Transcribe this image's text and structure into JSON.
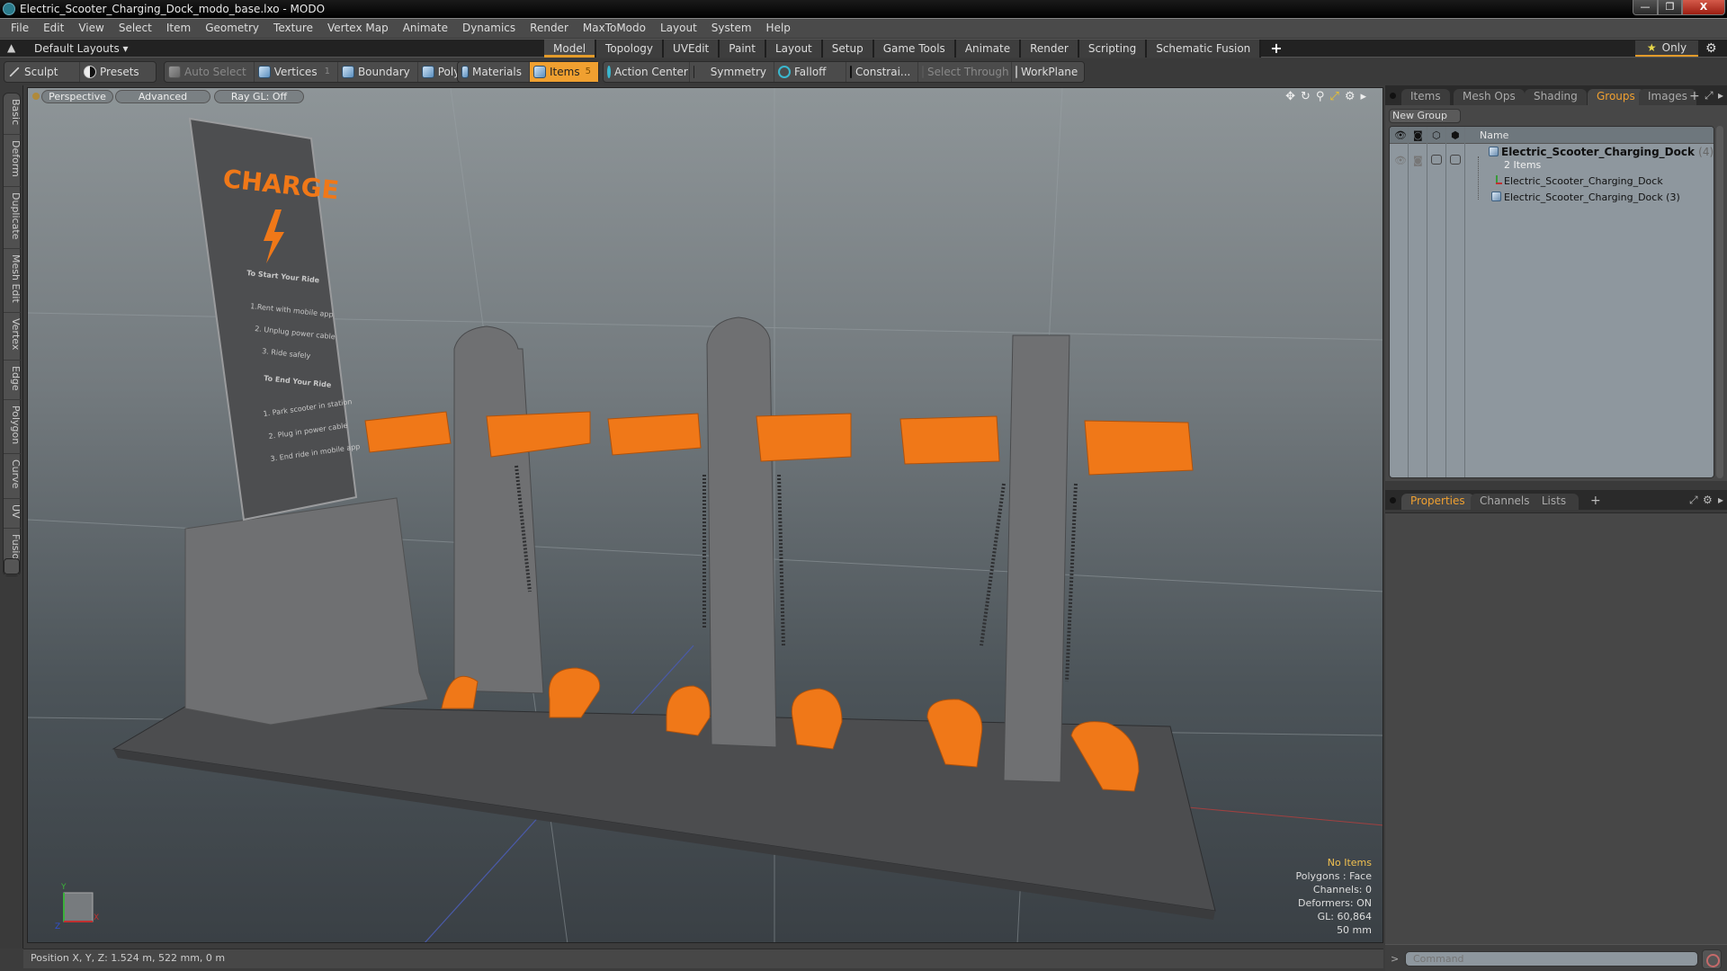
{
  "window": {
    "title": "Electric_Scooter_Charging_Dock_modo_base.lxo - MODO",
    "controls": {
      "minimize": "—",
      "maximize": "❐",
      "close": "X"
    }
  },
  "menu": [
    "File",
    "Edit",
    "View",
    "Select",
    "Item",
    "Geometry",
    "Texture",
    "Vertex Map",
    "Animate",
    "Dynamics",
    "Render",
    "MaxToModo",
    "Layout",
    "System",
    "Help"
  ],
  "layoutbar": {
    "layouts_label": "Default Layouts ▾",
    "tabs": [
      "Model",
      "Topology",
      "UVEdit",
      "Paint",
      "Layout",
      "Setup",
      "Game Tools",
      "Animate",
      "Render",
      "Scripting",
      "Schematic Fusion"
    ],
    "active_tab": "Model",
    "add_tab": "+",
    "only_label": "Only"
  },
  "toolbar": {
    "sculpt": "Sculpt",
    "presets": "Presets",
    "auto_select": "Auto Select",
    "vertices": "Vertices",
    "vertices_count": "1",
    "boundary": "Boundary",
    "polygons": "Polygons",
    "materials": "Materials",
    "items": "Items",
    "items_count": "5",
    "action_center": "Action Center",
    "symmetry": "Symmetry",
    "falloff": "Falloff",
    "constraints": "Constrai...",
    "select_through": "Select Through",
    "workplane": "WorkPlane"
  },
  "left_palette": [
    "Basic",
    "Deform",
    "Duplicate",
    "Mesh Edit",
    "Vertex",
    "Edge",
    "Polygon",
    "Curve",
    "UV",
    "Fusion"
  ],
  "viewport": {
    "view_mode": "Perspective",
    "advanced": "Advanced",
    "raygl": "Ray GL: Off",
    "info": {
      "selection": "No Items",
      "polygons": "Polygons : Face",
      "channels": "Channels: 0",
      "deformers": "Deformers: ON",
      "gl": "GL: 60,864",
      "scale": "50 mm"
    },
    "axis_labels": {
      "x": "X",
      "y": "Y",
      "z": "Z"
    },
    "sign": {
      "title": "CHARGE",
      "start_heading": "To Start Your Ride",
      "start_steps": [
        "1.Rent with mobile app",
        "2. Unplug power cable",
        "3. Ride safely"
      ],
      "end_heading": "To End Your Ride",
      "end_steps": [
        "1. Park scooter in station",
        "2. Plug in power cable",
        "3. End ride in mobile app"
      ]
    },
    "colors": {
      "accent_orange": "#f07818",
      "mesh_grey": "#6f7072"
    }
  },
  "statusbar": {
    "position": "Position X, Y, Z:   1.524 m, 522 mm, 0 m"
  },
  "groups_panel": {
    "tabs": [
      "Items",
      "Mesh Ops",
      "Shading",
      "Groups",
      "Images"
    ],
    "active_tab": "Groups",
    "new_group": "New Group",
    "column_name": "Name",
    "group": {
      "name": "Electric_Scooter_Charging_Dock",
      "count": "(4) :  ...",
      "sub": "2 Items",
      "children": [
        "Electric_Scooter_Charging_Dock",
        "Electric_Scooter_Charging_Dock (3)"
      ]
    }
  },
  "properties_panel": {
    "tabs": [
      "Properties",
      "Channels",
      "Lists"
    ],
    "active_tab": "Properties"
  },
  "command": {
    "prompt": ">",
    "placeholder": "Command"
  }
}
